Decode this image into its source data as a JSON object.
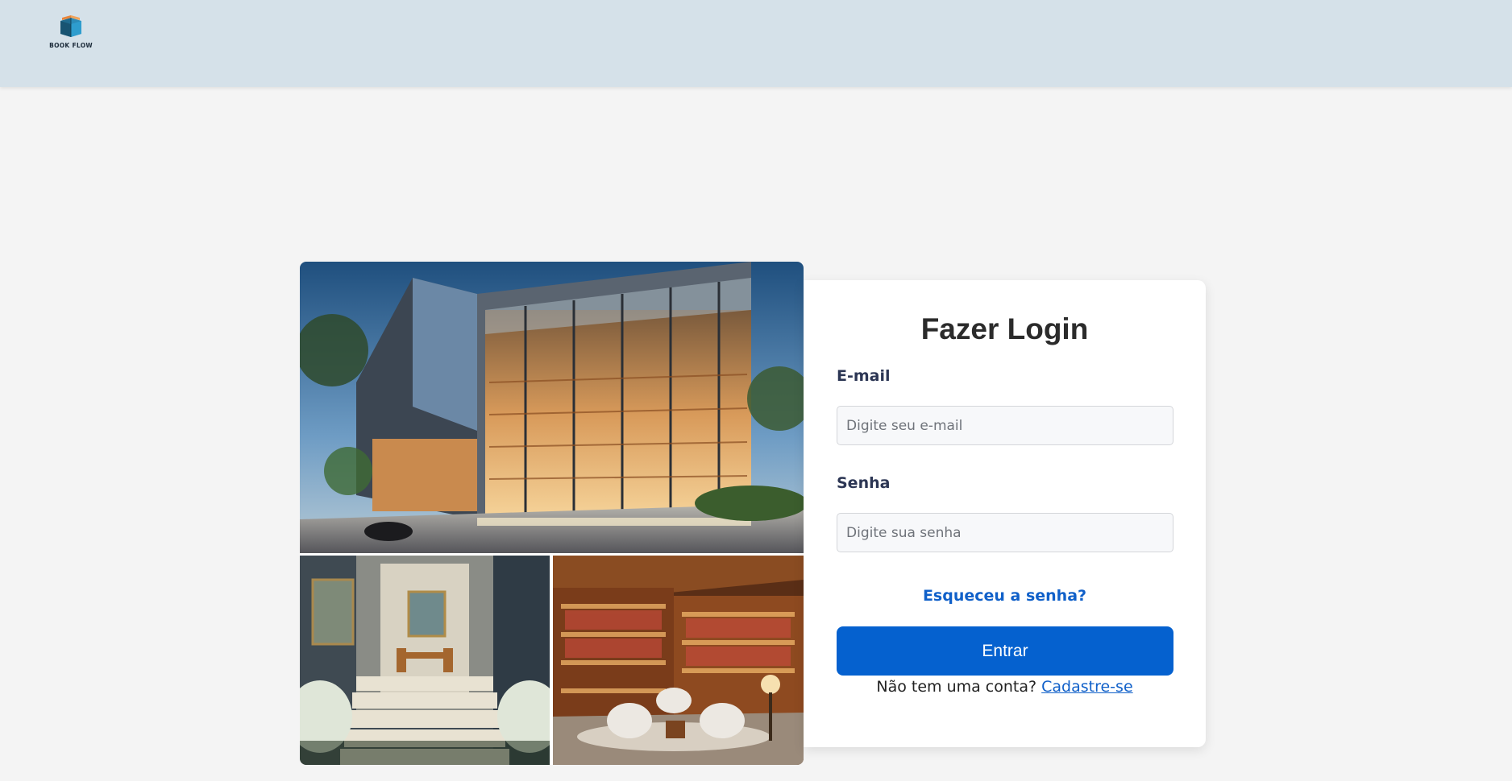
{
  "header": {
    "logo_text": "BOOK FLOW",
    "logo_icon": "open-book-icon",
    "background": "#d5e1e9"
  },
  "gallery": {
    "images": [
      {
        "name": "bookstore-exterior-photo",
        "icon": "building-image"
      },
      {
        "name": "stairs-entrance-photo",
        "icon": "stairs-image"
      },
      {
        "name": "reading-lounge-photo",
        "icon": "bookshelves-image"
      }
    ]
  },
  "login": {
    "title": "Fazer Login",
    "email_label": "E-mail",
    "email_placeholder": "Digite seu e-mail",
    "email_value": "",
    "password_label": "Senha",
    "password_placeholder": "Digite sua senha",
    "password_value": "",
    "forgot_label": "Esqueceu a senha?",
    "submit_label": "Entrar",
    "signup_prompt": "Não tem uma conta?",
    "signup_link": "Cadastre-se"
  },
  "colors": {
    "accent": "#0561cf",
    "link": "#1060c9",
    "label": "#2c3654",
    "page_background": "#f4f4f4"
  }
}
